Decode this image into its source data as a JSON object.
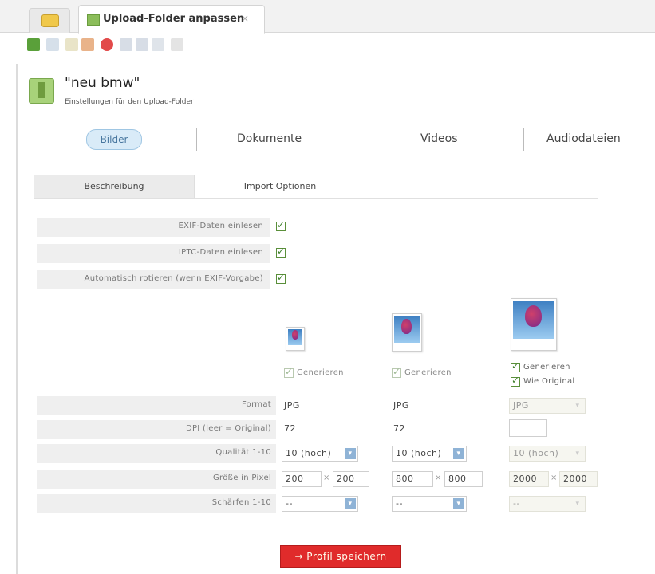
{
  "window": {
    "tab_title": "Upload-Folder anpassen",
    "tab_close": "×"
  },
  "header": {
    "title": "\"neu bmw\"",
    "subtitle": "Einstellungen für den Upload-Folder"
  },
  "media_tabs": [
    "Bilder",
    "Dokumente",
    "Videos",
    "Audiodateien"
  ],
  "sub_tabs": [
    "Beschreibung",
    "Import Optionen"
  ],
  "import_options": [
    {
      "label": "EXIF-Daten einlesen",
      "checked": true
    },
    {
      "label": "IPTC-Daten einlesen",
      "checked": true
    },
    {
      "label": "Automatisch rotieren (wenn EXIF-Vorgabe)",
      "checked": true
    }
  ],
  "sizes": {
    "col1": {
      "generate_label": "Generieren",
      "format": "JPG",
      "dpi": "72",
      "quality": "10 (hoch)",
      "width": "200",
      "height": "200",
      "sharpen": "--"
    },
    "col2": {
      "generate_label": "Generieren",
      "format": "JPG",
      "dpi": "72",
      "quality": "10 (hoch)",
      "width": "800",
      "height": "800",
      "sharpen": "--"
    },
    "col3": {
      "generate_label": "Generieren",
      "original_label": "Wie Original",
      "format": "JPG",
      "dpi": "",
      "quality": "10 (hoch)",
      "width": "2000",
      "height": "2000",
      "sharpen": "--"
    }
  },
  "table_labels": {
    "format": "Format",
    "dpi": "DPI (leer = Original)",
    "quality": "Qualität 1-10",
    "size": "Größe in Pixel",
    "sharpen": "Schärfen 1-10"
  },
  "times_symbol": "×",
  "save_button": "→ Profil speichern"
}
